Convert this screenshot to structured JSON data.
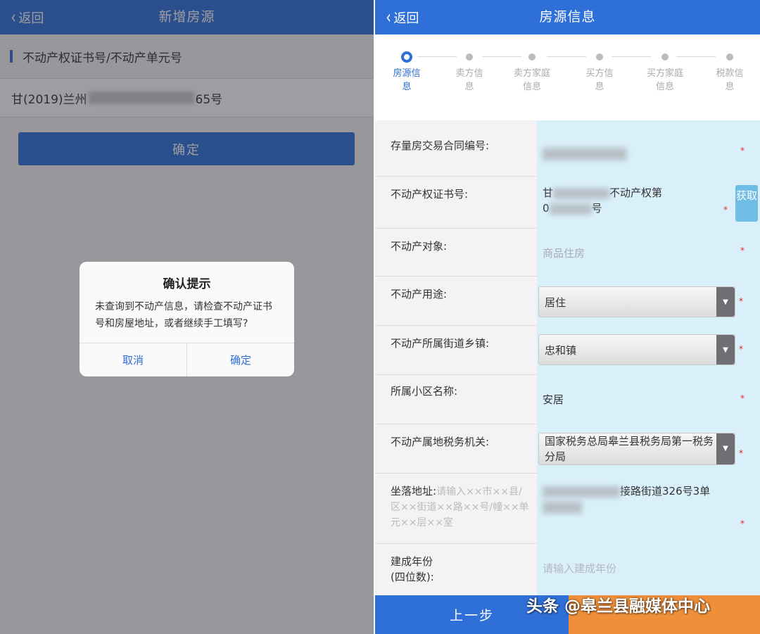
{
  "left": {
    "nav": {
      "back_label": "返回",
      "title": "新增房源"
    },
    "field_label": "不动产权证书号/不动产单元号",
    "cert_prefix": "甘(2019)兰州",
    "cert_suffix": "65号",
    "confirm_label": "确定",
    "dialog": {
      "title": "确认提示",
      "message": "未查询到不动产信息，请检查不动产证书号和房屋地址，或者继续手工填写?",
      "cancel_label": "取消",
      "ok_label": "确定"
    }
  },
  "right": {
    "nav": {
      "back_label": "返回",
      "title": "房源信息"
    },
    "steps": [
      {
        "label": "房源信息",
        "active": true
      },
      {
        "label": "卖方信息",
        "active": false
      },
      {
        "label": "卖方家庭信息",
        "active": false
      },
      {
        "label": "买方信息",
        "active": false
      },
      {
        "label": "买方家庭信息",
        "active": false
      },
      {
        "label": "税款信息",
        "active": false
      }
    ],
    "form": {
      "contract_no": {
        "label": "存量房交易合同编号:"
      },
      "cert_no": {
        "label": "不动产权证书号:",
        "value_prefix": "甘",
        "value_mid": "不动产权第",
        "value_line2_prefix": "0",
        "value_line2_suffix": "号",
        "fetch_label": "获取"
      },
      "object": {
        "label": "不动产对象:",
        "value": "商品住房"
      },
      "usage": {
        "label": "不动产用途:",
        "value": "居住"
      },
      "street": {
        "label": "不动产所属街道乡镇:",
        "value": "忠和镇"
      },
      "community": {
        "label": "所属小区名称:",
        "value": "安居"
      },
      "tax_office": {
        "label": "不动产属地税务机关:",
        "value": "国家税务总局皋兰县税务局第一税务分局"
      },
      "address": {
        "label": "坐落地址:",
        "placeholder": "请输入××市××县/区××街道××路××号/幢××单元××层××室",
        "value_suffix": "接路街道326号3单",
        "value_line2_suffix": ""
      },
      "build_year": {
        "label_line1": "建成年份",
        "label_line2": "(四位数):",
        "placeholder": "请输入建成年份"
      },
      "required_mark": "*"
    },
    "prev_label": "上一步"
  },
  "watermark": "头条 @皋兰县融媒体中心"
}
